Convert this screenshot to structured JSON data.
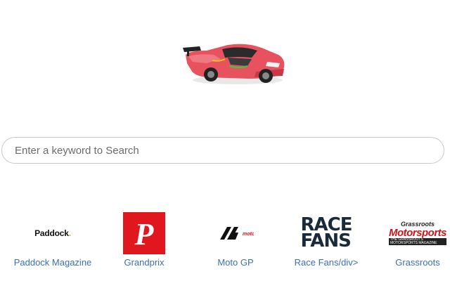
{
  "search": {
    "placeholder": "Enter a keyword to Search"
  },
  "logo": {
    "icon": "sports-car-icon"
  },
  "links": [
    {
      "label": "Paddock Magazine",
      "logo_text": "Paddock",
      "logo_dot": "."
    },
    {
      "label": "Grandprix",
      "logo_glyph": "P"
    },
    {
      "label": "Moto GP",
      "logo_text": "motogp"
    },
    {
      "label": "Race Fans/div>",
      "logo_line1": "RACE",
      "logo_line2": "FANS"
    },
    {
      "label": "Grassroots",
      "logo_top": "Grassroots",
      "logo_main": "Motorsports",
      "logo_sub": "THE GRASSROOTS MOTORSPORTS MAGAZINE"
    }
  ],
  "colors": {
    "link_blue": "#3a6fb5",
    "grandprix_red": "#e0171f",
    "search_border": "#c8c8c8"
  }
}
